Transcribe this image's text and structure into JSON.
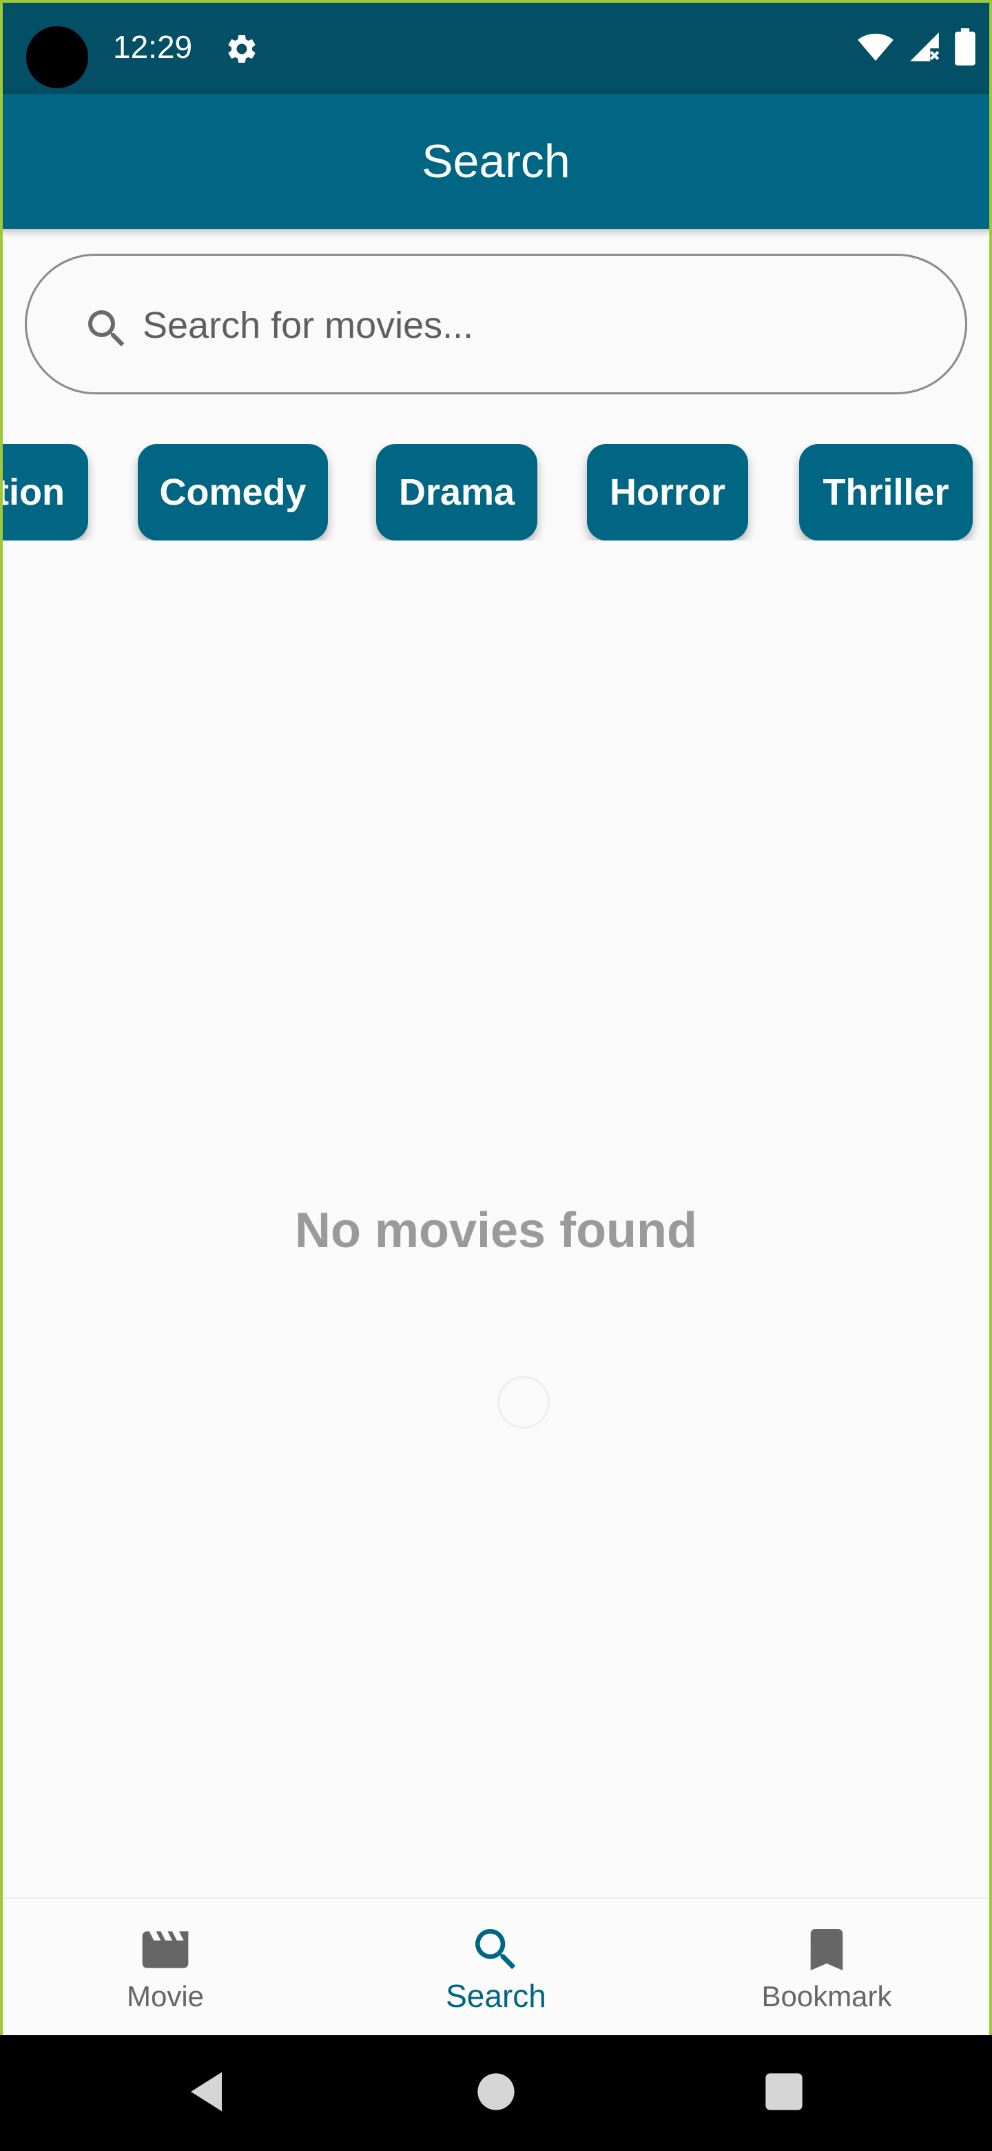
{
  "status_bar": {
    "time": "12:29",
    "icons": [
      "settings-icon",
      "wifi-icon",
      "signal-icon",
      "battery-icon"
    ]
  },
  "app_bar": {
    "title": "Search"
  },
  "search": {
    "placeholder": "Search for movies...",
    "value": "",
    "icon": "search-icon"
  },
  "genres": [
    {
      "label": "Action",
      "visible_text": "tion"
    },
    {
      "label": "Comedy"
    },
    {
      "label": "Drama"
    },
    {
      "label": "Horror"
    },
    {
      "label": "Thriller"
    }
  ],
  "empty_state": {
    "message": "No movies found"
  },
  "bottom_nav": {
    "items": [
      {
        "label": "Movie",
        "icon": "clapperboard-icon",
        "active": false
      },
      {
        "label": "Search",
        "icon": "search-icon",
        "active": true
      },
      {
        "label": "Bookmark",
        "icon": "bookmark-icon",
        "active": false
      }
    ]
  },
  "colors": {
    "primary": "#006683",
    "status_bar": "#034f66",
    "background": "#fafafa",
    "muted_text": "#9a9a9a",
    "frame": "#9fc83a"
  }
}
